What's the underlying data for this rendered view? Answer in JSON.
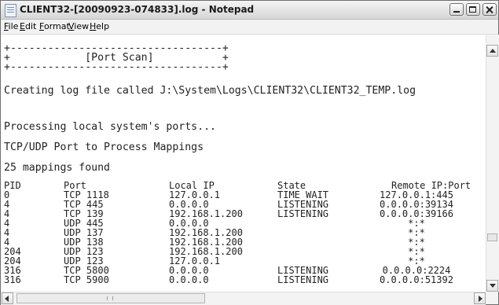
{
  "window": {
    "title": "CLIENT32-[20090923-074833].log - Notepad"
  },
  "menu": [
    "File",
    "Edit",
    "Format",
    "View",
    "Help"
  ],
  "content": {
    "lines": [
      "+----------------------------------+",
      "+            [Port Scan]           +",
      "+----------------------------------+",
      "Creating log file called J:\\System\\Logs\\CLIENT32\\CLIENT32_TEMP.log",
      "Processing local system's ports...",
      "TCP/UDP Port to Process Mappings",
      "25 mappings found"
    ],
    "table": {
      "headers": [
        "PID",
        "Port",
        "Local IP",
        "State",
        "Remote IP:Port"
      ],
      "rows": [
        [
          "0",
          "TCP 1118",
          "127.0.0.1",
          "TIME WAIT",
          "127.0.0.1:445"
        ],
        [
          "4",
          "TCP 445",
          "0.0.0.0",
          "LISTENING",
          "0.0.0.0:39134"
        ],
        [
          "4",
          "TCP 139",
          "192.168.1.200",
          "LISTENING",
          "0.0.0.0:39166"
        ],
        [
          "4",
          "UDP 445",
          "0.0.0.0",
          "",
          "*:*"
        ],
        [
          "4",
          "UDP 137",
          "192.168.1.200",
          "",
          "*:*"
        ],
        [
          "4",
          "UDP 138",
          "192.168.1.200",
          "",
          "*:*"
        ],
        [
          "204",
          "UDP 123",
          "192.168.1.200",
          "",
          "*:*"
        ],
        [
          "204",
          "UDP 123",
          "127.0.0.1",
          "",
          "*:*"
        ],
        [
          "316",
          "TCP 5800",
          "0.0.0.0",
          "LISTENING",
          "0.0.0.0:2224"
        ],
        [
          "316",
          "TCP 5900",
          "0.0.0.0",
          "LISTENING",
          "0.0.0.0:51392"
        ]
      ]
    }
  },
  "icons": {
    "app": "notepad-icon",
    "minimize": "minimize-icon",
    "maximize": "maximize-icon",
    "close": "close-icon"
  }
}
